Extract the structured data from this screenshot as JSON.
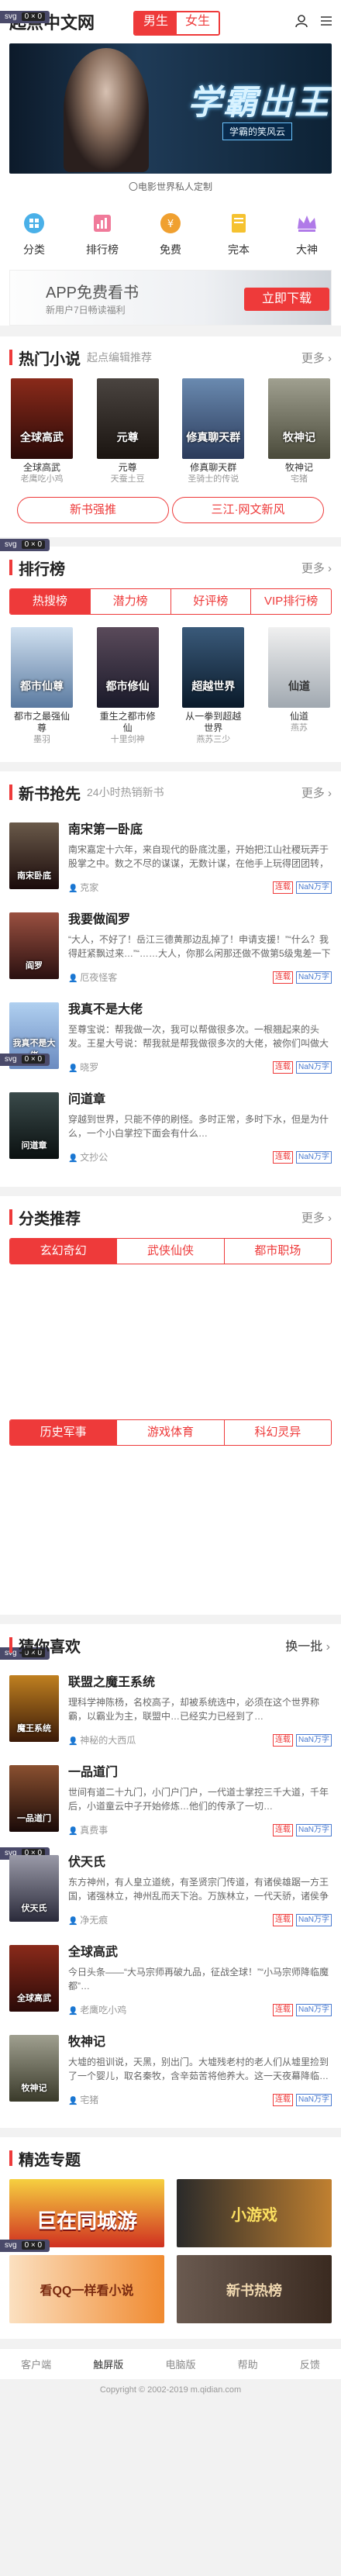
{
  "header": {
    "logo": "起点中文网",
    "gender_male": "男生",
    "gender_female": "女生"
  },
  "banner": {
    "title": "学霸出王",
    "subtitle": "学霸的笑风云",
    "caption": "〇电影世界私人定制"
  },
  "iconnav": [
    {
      "label": "分类",
      "icon": "category-icon"
    },
    {
      "label": "排行榜",
      "icon": "chart-icon"
    },
    {
      "label": "免费",
      "icon": "free-icon"
    },
    {
      "label": "完本",
      "icon": "book-icon"
    },
    {
      "label": "大神",
      "icon": "crown-icon"
    }
  ],
  "app_banner": {
    "title": "APP免费看书",
    "sub": "新用户7日畅读福利",
    "button": "立即下载"
  },
  "hot": {
    "title": "热门小说",
    "sub": "起点编辑推荐",
    "more": "更多",
    "books": [
      {
        "name": "全球高武",
        "author": "老鹰吃小鸡",
        "cover_text": "全球高武",
        "color": "#5a1a14"
      },
      {
        "name": "元尊",
        "author": "天蚕土豆",
        "cover_text": "元尊",
        "color": "#2a2420"
      },
      {
        "name": "修真聊天群",
        "author": "圣骑士的传说",
        "cover_text": "修真聊天群",
        "color": "#3a4a6a"
      },
      {
        "name": "牧神记",
        "author": "宅猪",
        "cover_text": "牧神记",
        "color": "#5a5a4a"
      }
    ],
    "pill_left": "新书强推",
    "pill_right": "三江·网文新风"
  },
  "rank": {
    "title": "排行榜",
    "more": "更多",
    "tabs": [
      "热搜榜",
      "潜力榜",
      "好评榜",
      "VIP排行榜"
    ],
    "books": [
      {
        "name": "都市之最强仙尊",
        "author": "墨羽",
        "cover_text": "都市仙尊",
        "color": "#6a8ab0"
      },
      {
        "name": "重生之都市修仙",
        "author": "十里剑神",
        "cover_text": "都市修仙",
        "color": "#2a2a3a"
      },
      {
        "name": "从一拳到超越世界",
        "author": "周渐",
        "cover_text": "超越世界",
        "color": "#1a2a3a"
      },
      {
        "name": "仙道",
        "author": "燕苏",
        "cover_text": "仙道",
        "color": "#c0c4c8"
      }
    ],
    "extra_author": "燕苏三少"
  },
  "newbooks": {
    "title": "新书抢先",
    "sub": "24小时热销新书",
    "more": "更多",
    "items": [
      {
        "title": "南宋第一卧底",
        "desc": "南宋嘉定十六年，来自现代的卧底沈墨，开始把江山社稷玩弄于股掌之中。数之不尽的谋谋，无数计谋，在他手上玩得团团转，他的现代…",
        "author": "克家",
        "tag1": "连载",
        "tag2": "NaN万字",
        "cover_text": "南宋卧底",
        "color": "#3a2a2a"
      },
      {
        "title": "我要做阎罗",
        "desc": "“大人，不好了！岳江三德黄那边乱掉了！申请支援！”“什么？我得赶紧飘过来…”“……大人，你那么闲那还做不做第5级鬼差一下呀！”",
        "author": "厄夜怪客",
        "tag1": "连载",
        "tag2": "NaN万字",
        "cover_text": "阎罗",
        "color": "#5a3030"
      },
      {
        "title": "我真不是大佬",
        "desc": "至尊宝说：帮我做一次，我可以帮做很多次。一根翘起来的头发。王星大号说：帮我就是帮我做很多次的大佬，被你们叫做大佬我也…",
        "author": "晓罗",
        "tag1": "连载",
        "tag2": "NaN万字",
        "cover_text": "我真不是大佬",
        "color": "#6a8ac0"
      },
      {
        "title": "问道章",
        "desc": "穿越到世界，只能不停的刷怪。多时正常，多时下水，但是为什么，一个小白掌控下面会有什么…",
        "author": "文抄公",
        "tag1": "连载",
        "tag2": "NaN万字",
        "cover_text": "问道章",
        "color": "#1a2a2a"
      }
    ]
  },
  "category": {
    "title": "分类推荐",
    "more": "更多",
    "tabs1": [
      "玄幻奇幻",
      "武侠仙侠",
      "都市职场"
    ],
    "tabs2": [
      "历史军事",
      "游戏体育",
      "科幻灵异"
    ]
  },
  "guess": {
    "title": "猜你喜欢",
    "change": "换一批",
    "items": [
      {
        "title": "联盟之魔王系统",
        "desc": "理科学神陈杨，名校高子，却被系统选中，必须在这个世界称霸，以霸业为主，联盟中…已经实力已经到了…",
        "author": "神秘的大西瓜",
        "tag1": "连载",
        "tag2": "NaN万字",
        "cover_text": "魔王系统",
        "color": "#3a2010"
      },
      {
        "title": "一品道门",
        "desc": "世间有道二十九门，小门户门户，一代道士掌控三千大道，千年后，小道童云中子开始修炼…他们的传承了一切…",
        "author": "真费事",
        "tag1": "连载",
        "tag2": "NaN万字",
        "cover_text": "一品道门",
        "color": "#2a2020"
      },
      {
        "title": "伏天氏",
        "desc": "东方神州，有人皇立道统，有圣贤宗门传道，有诸侯雄踞一方王国，诸强林立，神州乱而天下治。万族林立，一代天骄，诸侯争霸…",
        "author": "净无痕",
        "tag1": "连载",
        "tag2": "NaN万字",
        "cover_text": "伏天氏",
        "color": "#4a4a5a"
      },
      {
        "title": "全球高武",
        "desc": "今日头条——“大马宗师再破九品，征战全球！”“小马宗师降临魔都”…",
        "author": "老鹰吃小鸡",
        "tag1": "连载",
        "tag2": "NaN万字",
        "cover_text": "全球高武",
        "color": "#5a1a14"
      },
      {
        "title": "牧神记",
        "desc": "大墟的祖训说，天黑，别出门。大墟残老村的老人们从墟里捡到了一个婴儿，取名秦牧，含辛茹苦将他养大。这一天夜幕降临…",
        "author": "宅猪",
        "tag1": "连载",
        "tag2": "NaN万字",
        "cover_text": "牧神记",
        "color": "#5a5a4a"
      }
    ]
  },
  "special": {
    "title": "精选专题",
    "items": [
      {
        "text": "巨在同城游",
        "color": "#c03030"
      },
      {
        "text": "小游戏",
        "color": "#e0a040"
      },
      {
        "text": "看QQ一样看小说",
        "color": "#e07a20"
      },
      {
        "text": "新书热榜",
        "color": "#4a4040"
      }
    ]
  },
  "bottom_nav": [
    "客户端",
    "触屏版",
    "电脑版",
    "帮助",
    "反馈"
  ],
  "footer": "Copyright © 2002-2019 m.qidian.com"
}
